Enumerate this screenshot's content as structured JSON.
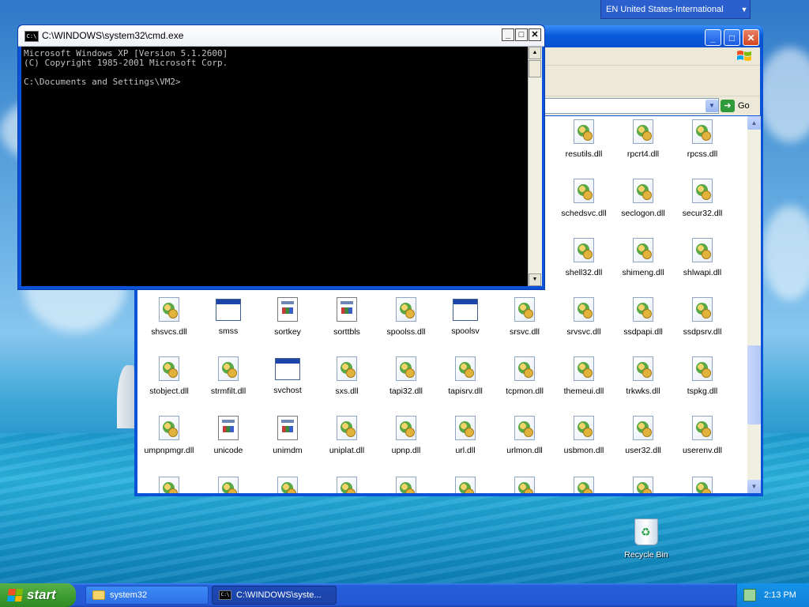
{
  "language_bar": {
    "text": "EN United States-International",
    "arrow_icon": "chevron-down-icon"
  },
  "explorer": {
    "window_title": "system32",
    "go_label": "Go",
    "files": [
      {
        "name": "resutils.dll",
        "type": "dll"
      },
      {
        "name": "rpcrt4.dll",
        "type": "dll"
      },
      {
        "name": "rpcss.dll",
        "type": "dll"
      },
      {
        "name": "schedsvc.dll",
        "type": "dll"
      },
      {
        "name": "seclogon.dll",
        "type": "dll"
      },
      {
        "name": "secur32.dll",
        "type": "dll"
      },
      {
        "name": "shell32.dll",
        "type": "dll"
      },
      {
        "name": "shimeng.dll",
        "type": "dll"
      },
      {
        "name": "shlwapi.dll",
        "type": "dll"
      },
      {
        "name": "shsvcs.dll",
        "type": "dll"
      },
      {
        "name": "smss",
        "type": "exe"
      },
      {
        "name": "sortkey",
        "type": "doc"
      },
      {
        "name": "sorttbls",
        "type": "doc"
      },
      {
        "name": "spoolss.dll",
        "type": "dll"
      },
      {
        "name": "spoolsv",
        "type": "exe"
      },
      {
        "name": "srsvc.dll",
        "type": "dll"
      },
      {
        "name": "srvsvc.dll",
        "type": "dll"
      },
      {
        "name": "ssdpapi.dll",
        "type": "dll"
      },
      {
        "name": "ssdpsrv.dll",
        "type": "dll"
      },
      {
        "name": "stobject.dll",
        "type": "dll"
      },
      {
        "name": "strmfilt.dll",
        "type": "dll"
      },
      {
        "name": "svchost",
        "type": "exe"
      },
      {
        "name": "sxs.dll",
        "type": "dll"
      },
      {
        "name": "tapi32.dll",
        "type": "dll"
      },
      {
        "name": "tapisrv.dll",
        "type": "dll"
      },
      {
        "name": "tcpmon.dll",
        "type": "dll"
      },
      {
        "name": "themeui.dll",
        "type": "dll"
      },
      {
        "name": "trkwks.dll",
        "type": "dll"
      },
      {
        "name": "tspkg.dll",
        "type": "dll"
      },
      {
        "name": "umpnpmgr.dll",
        "type": "dll"
      },
      {
        "name": "unicode",
        "type": "doc"
      },
      {
        "name": "unimdm",
        "type": "doc"
      },
      {
        "name": "uniplat.dll",
        "type": "dll"
      },
      {
        "name": "upnp.dll",
        "type": "dll"
      },
      {
        "name": "url.dll",
        "type": "dll"
      },
      {
        "name": "urlmon.dll",
        "type": "dll"
      },
      {
        "name": "usbmon.dll",
        "type": "dll"
      },
      {
        "name": "user32.dll",
        "type": "dll"
      },
      {
        "name": "userenv.dll",
        "type": "dll"
      }
    ]
  },
  "cmd": {
    "window_title": "C:\\WINDOWS\\system32\\cmd.exe",
    "icon_label": "C:\\",
    "lines": [
      "Microsoft Windows XP [Version 5.1.2600]",
      "(C) Copyright 1985-2001 Microsoft Corp.",
      "",
      "C:\\Documents and Settings\\VM2>"
    ]
  },
  "desktop": {
    "recycle_bin_label": "Recycle Bin"
  },
  "taskbar": {
    "start_label": "start",
    "buttons": [
      {
        "label": "system32",
        "icon": "folder-icon"
      },
      {
        "label": "C:\\WINDOWS\\syste...",
        "icon": "cmd-icon"
      }
    ],
    "clock": "2:13 PM"
  }
}
